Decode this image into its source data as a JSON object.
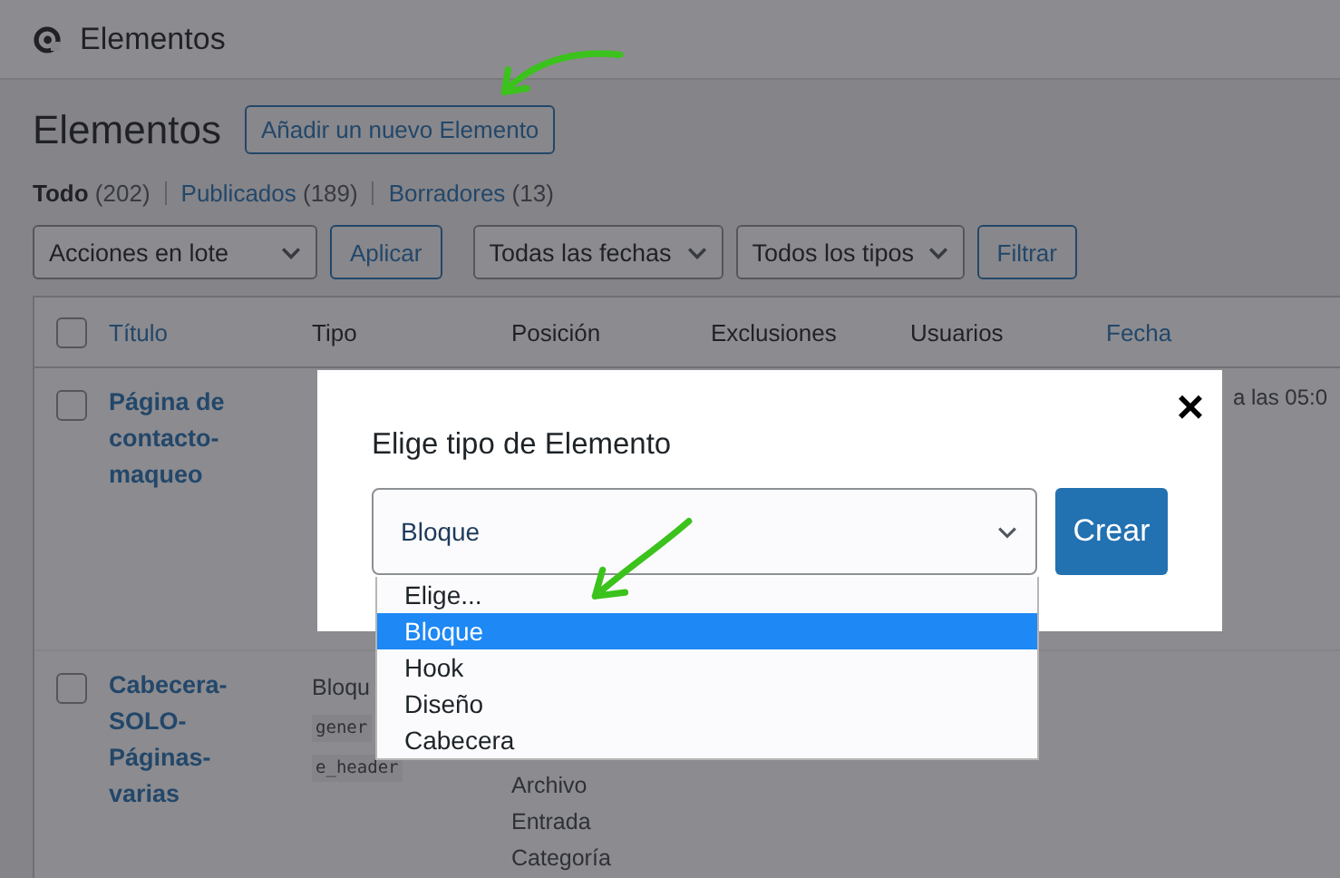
{
  "header": {
    "title": "Elementos"
  },
  "page": {
    "title": "Elementos",
    "add_button": "Añadir un nuevo Elemento"
  },
  "filters": [
    {
      "label": "Todo",
      "count": "(202)",
      "selected": true
    },
    {
      "label": "Publicados",
      "count": "(189)",
      "selected": false
    },
    {
      "label": "Borradores",
      "count": "(13)",
      "selected": false
    }
  ],
  "toolbar": [
    {
      "kind": "select",
      "label": "Acciones en lote"
    },
    {
      "kind": "button",
      "label": "Aplicar"
    },
    {
      "kind": "select",
      "label": "Todas las fechas"
    },
    {
      "kind": "select",
      "label": "Todos los tipos"
    },
    {
      "kind": "button",
      "label": "Filtrar"
    }
  ],
  "table": {
    "header_checked": false,
    "columns": [
      {
        "label": "Título",
        "sortable": true
      },
      {
        "label": "Tipo",
        "sortable": false
      },
      {
        "label": "Posición",
        "sortable": false
      },
      {
        "label": "Exclusiones",
        "sortable": false
      },
      {
        "label": "Usuarios",
        "sortable": false
      },
      {
        "label": "Fecha",
        "sortable": true
      }
    ],
    "rows": [
      {
        "title": "Página de contacto-maqueo",
        "checked": false,
        "type": "",
        "tags": [],
        "positions": [],
        "date": "a las 05:0"
      },
      {
        "title": "Cabecera-SOLO-Páginas-varias",
        "checked": false,
        "type": "Bloqu",
        "tags": [
          "gener",
          "e_header"
        ],
        "positions": [
          "Archivo",
          "Entrada",
          "Categoría"
        ],
        "date": ""
      }
    ]
  },
  "modal": {
    "title": "Elige tipo de Elemento",
    "close": "×",
    "value": "Bloque",
    "create_button": "Crear",
    "options": [
      {
        "label": "Elige...",
        "selected": false
      },
      {
        "label": "Bloque",
        "selected": true
      },
      {
        "label": "Hook",
        "selected": false
      },
      {
        "label": "Diseño",
        "selected": false
      },
      {
        "label": "Cabecera",
        "selected": false
      }
    ]
  }
}
